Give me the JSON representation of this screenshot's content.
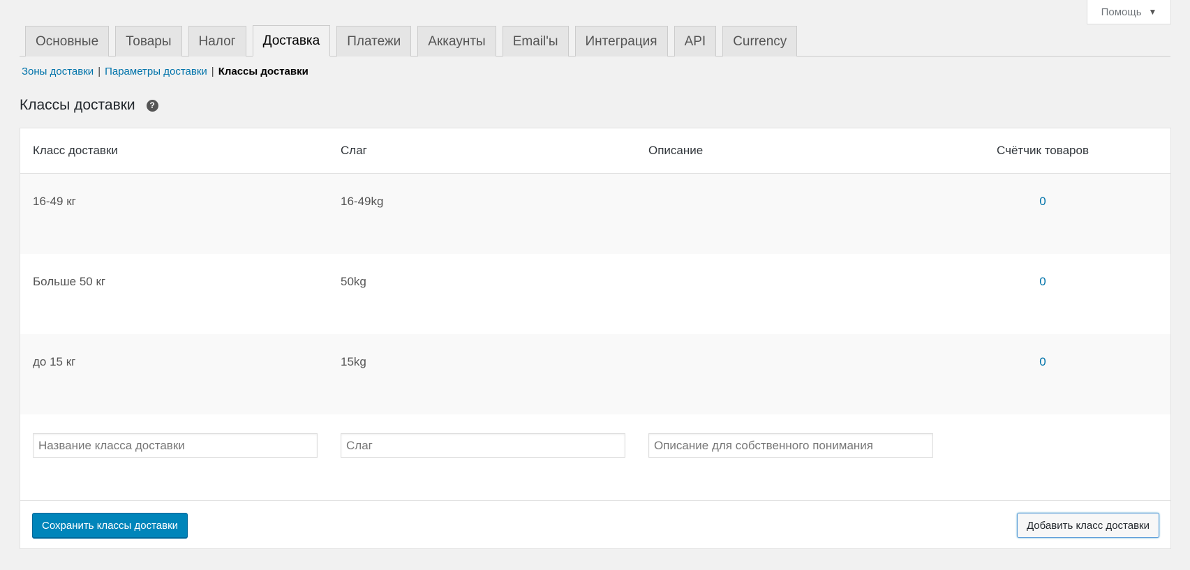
{
  "help": {
    "label": "Помощь",
    "icon": "triangle-down-icon"
  },
  "tabs": [
    {
      "label": "Основные"
    },
    {
      "label": "Товары"
    },
    {
      "label": "Налог"
    },
    {
      "label": "Доставка",
      "active": true
    },
    {
      "label": "Платежи"
    },
    {
      "label": "Аккаунты"
    },
    {
      "label": "Email'ы"
    },
    {
      "label": "Интеграция"
    },
    {
      "label": "API"
    },
    {
      "label": "Currency"
    }
  ],
  "subnav": {
    "zones": "Зоны доставки",
    "options": "Параметры доставки",
    "classes": "Классы доставки"
  },
  "page": {
    "title": "Классы доставки",
    "help_icon": "question-circle-icon"
  },
  "table": {
    "headers": {
      "class": "Класс доставки",
      "slug": "Слаг",
      "description": "Описание",
      "count": "Счётчик товаров"
    },
    "rows": [
      {
        "name": "16-49 кг",
        "slug": "16-49kg",
        "description": "",
        "count": "0"
      },
      {
        "name": "Больше 50 кг",
        "slug": "50kg",
        "description": "",
        "count": "0"
      },
      {
        "name": "до 15 кг",
        "slug": "15kg",
        "description": "",
        "count": "0"
      }
    ],
    "new_row": {
      "name_placeholder": "Название класса доставки",
      "slug_placeholder": "Слаг",
      "description_placeholder": "Описание для собственного понимания"
    }
  },
  "actions": {
    "save": "Сохранить классы доставки",
    "add": "Добавить класс доставки"
  },
  "colors": {
    "accent": "#0085ba",
    "link": "#0073aa",
    "background": "#f1f1f1"
  }
}
